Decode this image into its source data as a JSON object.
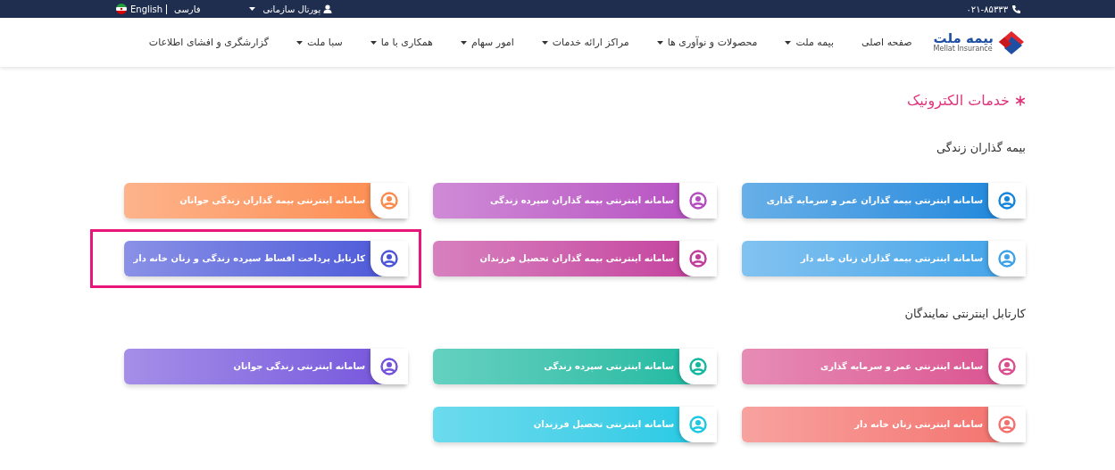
{
  "top_bar": {
    "phone": "۰۲۱-۸۵۳۳۳",
    "portal": {
      "label": "پورتال سازمانی",
      "dropdown": true
    },
    "languages": [
      "فارسی",
      "English"
    ]
  },
  "logo": {
    "name": "بیمه ملت",
    "subtitle": "Mellat Insurance"
  },
  "nav": [
    {
      "label": "صفحه اصلی",
      "dropdown": false
    },
    {
      "label": "بیمه ملت",
      "dropdown": true
    },
    {
      "label": "محصولات و نوآوری ها",
      "dropdown": true
    },
    {
      "label": "مراکز ارائه خدمات",
      "dropdown": true
    },
    {
      "label": "امور سهام",
      "dropdown": true
    },
    {
      "label": "همکاری با ما",
      "dropdown": true
    },
    {
      "label": "سبا ملت",
      "dropdown": true
    },
    {
      "label": "گزارشگری و افشای اطلاعات",
      "dropdown": false
    }
  ],
  "page_title": "خدمات الکترونیک",
  "sections": [
    {
      "title": "بیمه گذاران زندگی",
      "cards": [
        {
          "label": "سامانه اینترنتی بیمه گذاران عمر و سرمایه گذاری",
          "color": "#1585db",
          "highlighted": false
        },
        {
          "label": "سامانه اینترنتی بیمه گذاران سپرده زندگی",
          "color": "#b54cc0",
          "highlighted": false
        },
        {
          "label": "سامانه اینترنتی بیمه گذاران زندگی جوانان",
          "color": "#fc8a4c",
          "highlighted": false
        },
        {
          "label": "سامانه اینترنتی بیمه گذاران زنان خانه دار",
          "color": "#3ea2e8",
          "highlighted": false
        },
        {
          "label": "سامانه اینترنتی بیمه گذاران تحصیل فرزندان",
          "color": "#c23c9c",
          "highlighted": false
        },
        {
          "label": "کارتابل پرداخت اقساط سپرده زندگی و زنان خانه دار",
          "color": "#4b55d8",
          "highlighted": true
        }
      ]
    },
    {
      "title": "کارتابل اینترنتی نمایندگان",
      "cards": [
        {
          "label": "سامانه اینترنتی عمر و سرمایه گذاری",
          "color": "#d94e8e",
          "highlighted": false
        },
        {
          "label": "سامانه اینترنتی سپرده زندگی",
          "color": "#11b89f",
          "highlighted": false
        },
        {
          "label": "سامانه اینترنتی زندگی جوانان",
          "color": "#7452db",
          "highlighted": false
        },
        {
          "label": "سامانه اینترنتی زنان خانه دار",
          "color": "#f3706c",
          "highlighted": false
        },
        {
          "label": "سامانه اینترنتی تحصیل فرزندان",
          "color": "#1cc8e4",
          "highlighted": false
        }
      ]
    }
  ]
}
